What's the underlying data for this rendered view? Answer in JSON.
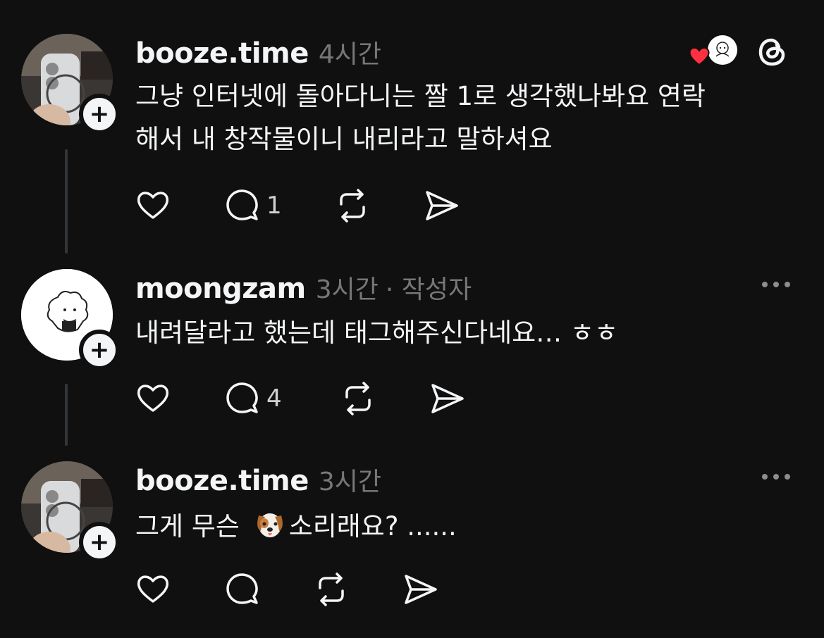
{
  "posts": [
    {
      "username": "booze.time",
      "time": "4시간",
      "lines": [
        "그냥 인터넷에 돌아다니는 짤 1로 생각했나봐요 연락",
        "해서 내 창작물이니 내리라고 말하셔요"
      ],
      "reply_count": "1"
    },
    {
      "username": "moongzam",
      "time": "3시간",
      "author_tag": "· 작성자",
      "lines": [
        "내려달라고 했는데 태그해주신다네요… ㅎㅎ"
      ],
      "reply_count": "4"
    },
    {
      "username": "booze.time",
      "time": "3시간",
      "text_before_emoji": "그게 무슨 ",
      "emoji_icon": "dog-face-emoji",
      "text_after_emoji": "소리래요? ......",
      "reply_count": ""
    }
  ],
  "colors": {
    "background": "#101010",
    "text": "#f3f5f7",
    "muted": "#777777",
    "heart_red": "#ff3040"
  },
  "icons": [
    "heart-icon",
    "comment-icon",
    "repost-icon",
    "share-icon",
    "threads-logo-icon",
    "more-icon"
  ]
}
